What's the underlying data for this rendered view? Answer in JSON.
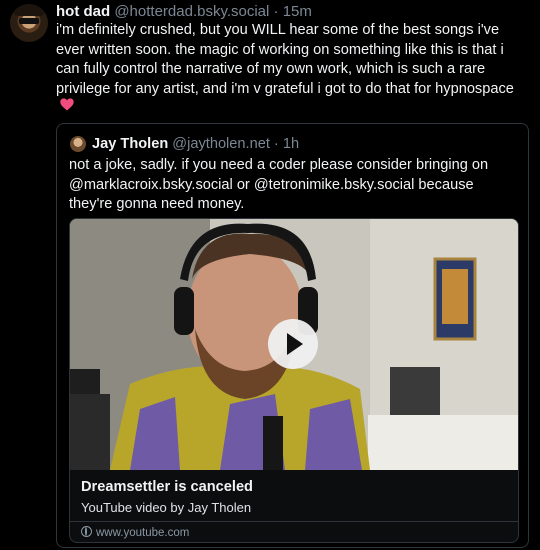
{
  "post": {
    "author_name": "hot dad",
    "author_handle": "@hotterdad.bsky.social",
    "separator": " · ",
    "time": "15m",
    "text": "i'm definitely crushed, but you WILL hear some of the best songs i've ever written soon. the magic of working on something like this is that i can fully control the narrative of my own work, which is such a rare privilege for any artist, and i'm v grateful i got to do that for hypnospace",
    "emoji_icon": "pink-heart-icon"
  },
  "quote": {
    "author_name": "Jay Tholen",
    "author_handle": "@jaytholen.net",
    "separator": " · ",
    "time": "1h",
    "text": "not a joke, sadly. if you need a coder please consider bringing on @marklacroix.bsky.social or @tetronimike.bsky.social because they're gonna need money.",
    "card": {
      "title": "Dreamsettler is canceled",
      "description": "YouTube video by Jay Tholen",
      "link": "www.youtube.com",
      "link_icon": "globe-icon",
      "play_icon": "play-icon"
    }
  },
  "colors": {
    "background": "#000000",
    "text": "#f1f3f5",
    "muted": "#7b8794",
    "border": "#2e3439",
    "heart": "#ef4d7d"
  }
}
